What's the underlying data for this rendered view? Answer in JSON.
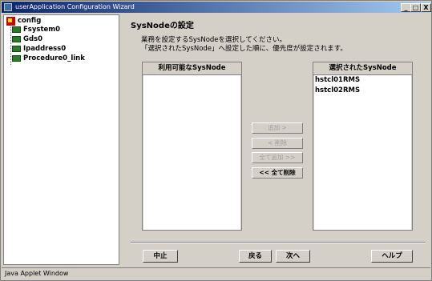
{
  "window": {
    "title": "userApplication Configuration Wizard",
    "minimize": "_",
    "maximize": "□",
    "close": "X"
  },
  "tree": {
    "root": "config",
    "children": [
      "Fsystem0",
      "Gds0",
      "Ipaddress0",
      "Procedure0_link"
    ]
  },
  "main": {
    "title": "SysNodeの設定",
    "description_line1": "業務を設定するSysNodeを選択してください。",
    "description_line2": "「選択されたSysNode」へ設定した順に、優先度が設定されます。"
  },
  "available_list": {
    "header": "利用可能なSysNode",
    "items": []
  },
  "selected_list": {
    "header": "選択されたSysNode",
    "items": [
      "hstcl01RMS",
      "hstcl02RMS"
    ]
  },
  "transfer_buttons": {
    "add": "追加 >",
    "remove": "< 削除",
    "add_all": "全て追加 >>",
    "remove_all": "<< 全て削除"
  },
  "bottom_buttons": {
    "cancel": "中止",
    "back": "戻る",
    "next": "次へ",
    "help": "ヘルプ"
  },
  "status": {
    "text": "Java Applet Window"
  },
  "colors": {
    "titlebar_start": "#0a246a",
    "titlebar_end": "#a6caf0",
    "root_icon": "#d00000",
    "resource_icon": "#2a7a2a"
  }
}
